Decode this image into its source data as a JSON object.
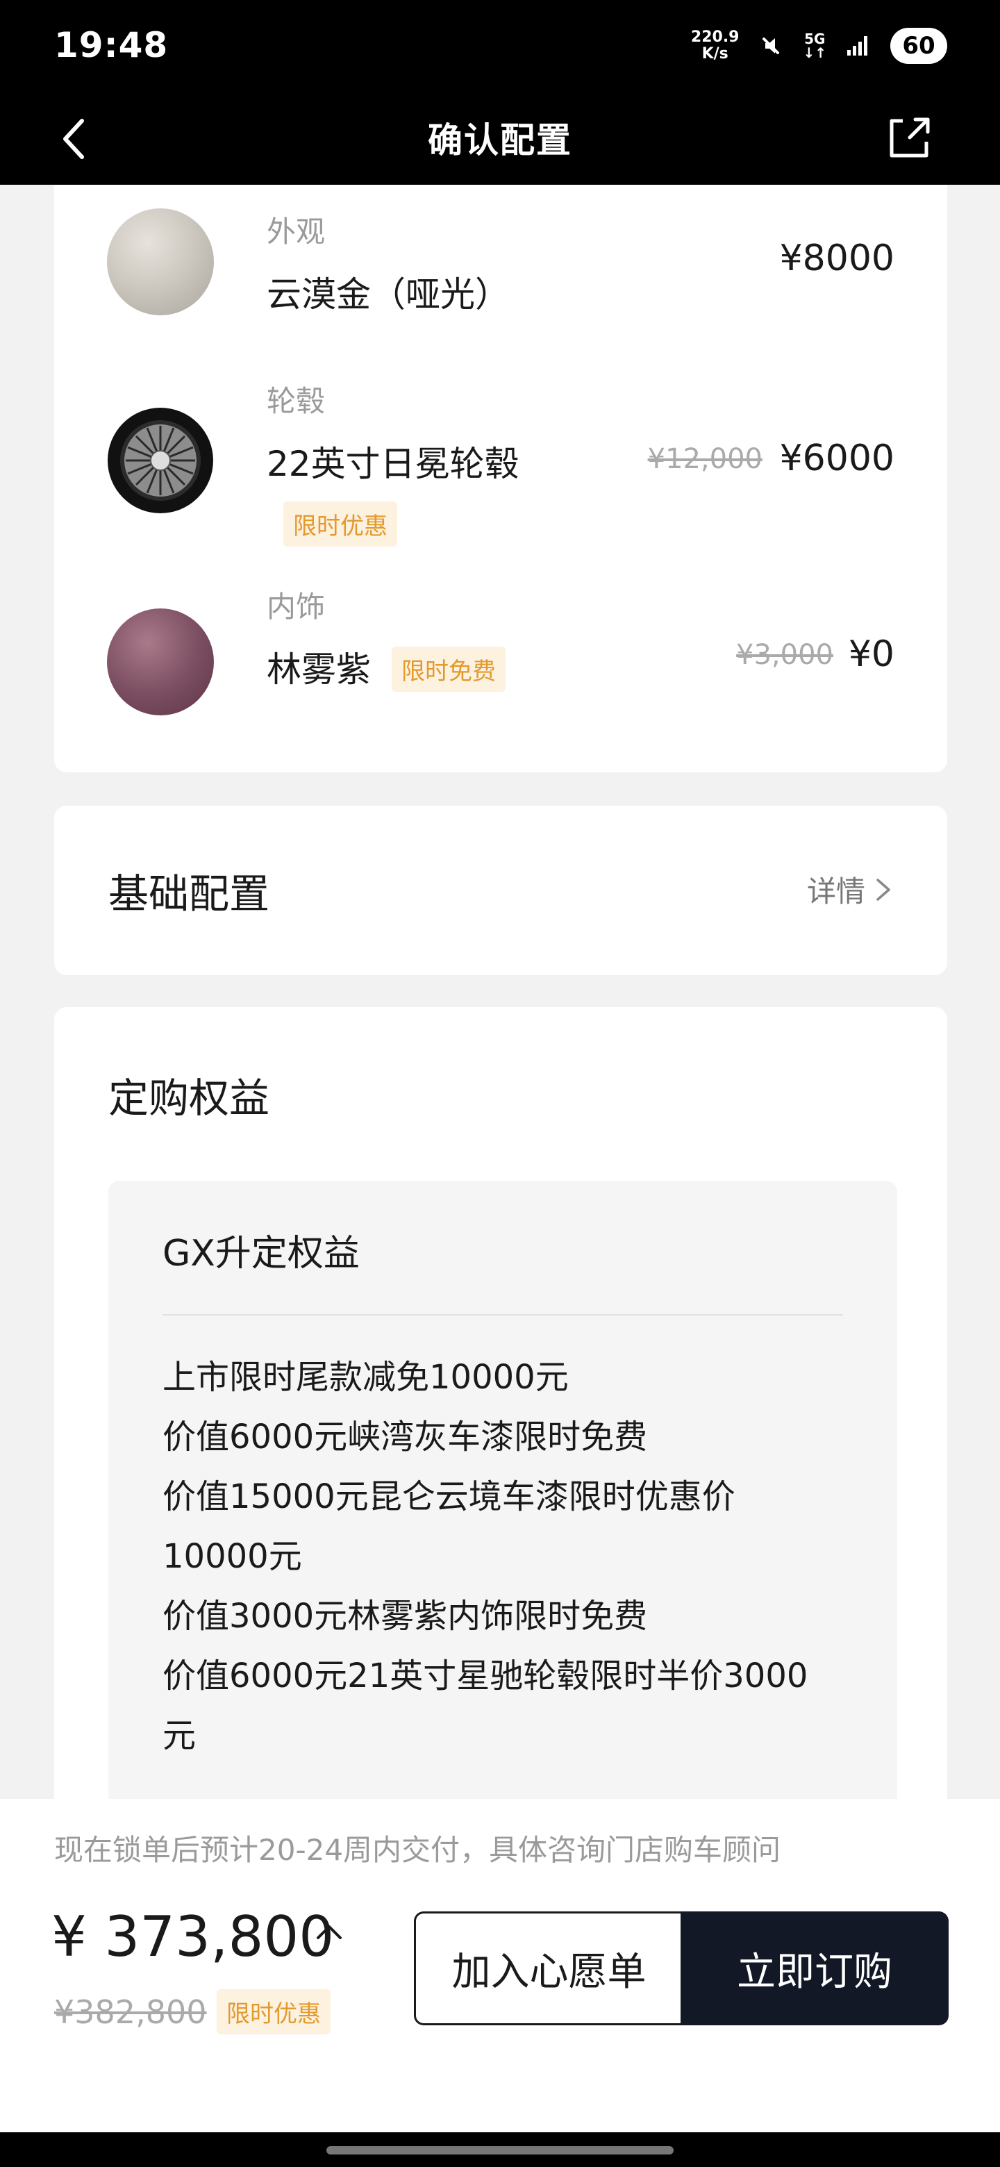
{
  "status_bar": {
    "time": "19:48",
    "net_speed_value": "220.9",
    "net_speed_unit": "K/s",
    "network": "5G",
    "battery": "60"
  },
  "header": {
    "title": "确认配置"
  },
  "options": [
    {
      "category": "外观",
      "name": "云漠金（哑光）",
      "price": "¥8000"
    },
    {
      "category": "轮毂",
      "name": "22英寸日冕轮毂",
      "tag": "限时优惠",
      "old_price": "¥12,000",
      "price": "¥6000"
    },
    {
      "category": "内饰",
      "name": "林雾紫",
      "tag": "限时免费",
      "old_price": "¥3,000",
      "price": "¥0"
    }
  ],
  "basic_config": {
    "title": "基础配置",
    "detail_label": "详情"
  },
  "benefits": {
    "title": "定购权益",
    "box_title": "GX升定权益",
    "items": [
      "上市限时尾款减免10000元",
      "价值6000元峡湾灰车漆限时免费",
      "价值15000元昆仑云境车漆限时优惠价10000元",
      "价值3000元林雾紫内饰限时免费",
      "价值6000元21英寸星驰轮毂限时半价3000元"
    ]
  },
  "bottom_bar": {
    "delivery_note": "现在锁单后预计20-24周内交付，具体咨询门店购车顾问",
    "total_price": "¥ 373,800",
    "old_total": "¥382,800",
    "tag": "限时优惠",
    "wishlist_label": "加入心愿单",
    "buy_label": "立即订购"
  },
  "colors": {
    "accent_tag_bg": "#fdf1df",
    "accent_tag_text": "#e39a2c",
    "buy_button": "#131826"
  }
}
